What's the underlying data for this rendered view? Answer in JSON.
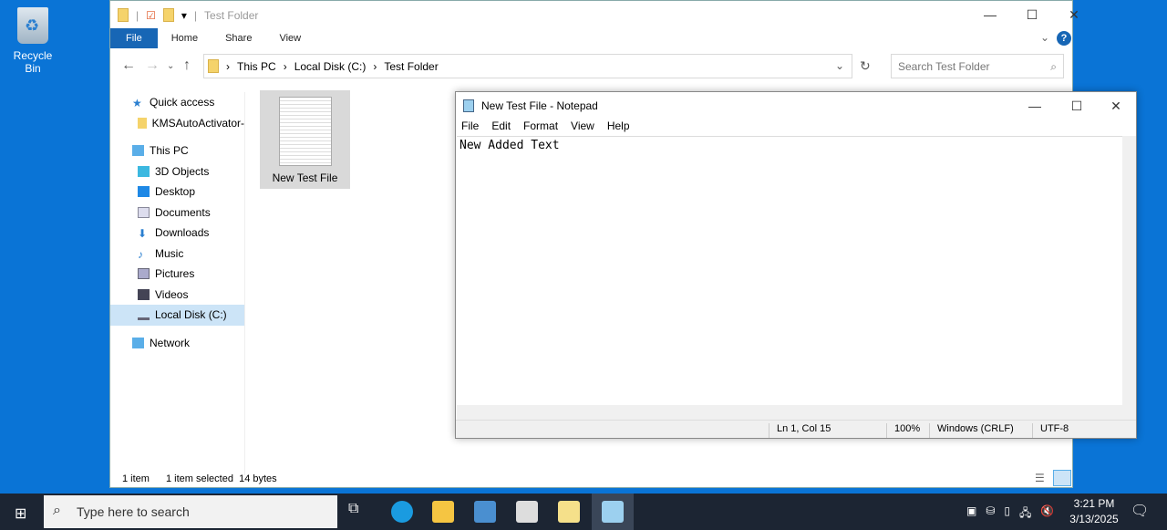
{
  "desktop": {
    "recycle_bin": "Recycle Bin"
  },
  "explorer": {
    "title": "Test Folder",
    "tabs": [
      "File",
      "Home",
      "Share",
      "View"
    ],
    "breadcrumb": [
      "This PC",
      "Local Disk (C:)",
      "Test Folder"
    ],
    "search_placeholder": "Search Test Folder",
    "nav": [
      {
        "label": "Quick access",
        "icon": "star-icon"
      },
      {
        "label": "KMSAutoActivator-",
        "icon": "folder-icon"
      },
      {
        "label": "This PC",
        "icon": "computer-icon"
      },
      {
        "label": "3D Objects",
        "icon": "cube-icon"
      },
      {
        "label": "Desktop",
        "icon": "desktop-icon"
      },
      {
        "label": "Documents",
        "icon": "documents-icon"
      },
      {
        "label": "Downloads",
        "icon": "download-icon"
      },
      {
        "label": "Music",
        "icon": "music-icon"
      },
      {
        "label": "Pictures",
        "icon": "pictures-icon"
      },
      {
        "label": "Videos",
        "icon": "videos-icon"
      },
      {
        "label": "Local Disk (C:)",
        "icon": "drive-icon"
      },
      {
        "label": "Network",
        "icon": "network-icon"
      }
    ],
    "file": "New Test File",
    "status": {
      "count": "1 item",
      "selected": "1 item selected",
      "size": "14 bytes"
    }
  },
  "notepad": {
    "title": "New Test File - Notepad",
    "menu": [
      "File",
      "Edit",
      "Format",
      "View",
      "Help"
    ],
    "content": "New Added Text",
    "status": {
      "position": "Ln 1, Col 15",
      "zoom": "100%",
      "eol": "Windows (CRLF)",
      "encoding": "UTF-8"
    }
  },
  "taskbar": {
    "search_placeholder": "Type here to search",
    "time": "3:21 PM",
    "date": "3/13/2025"
  }
}
